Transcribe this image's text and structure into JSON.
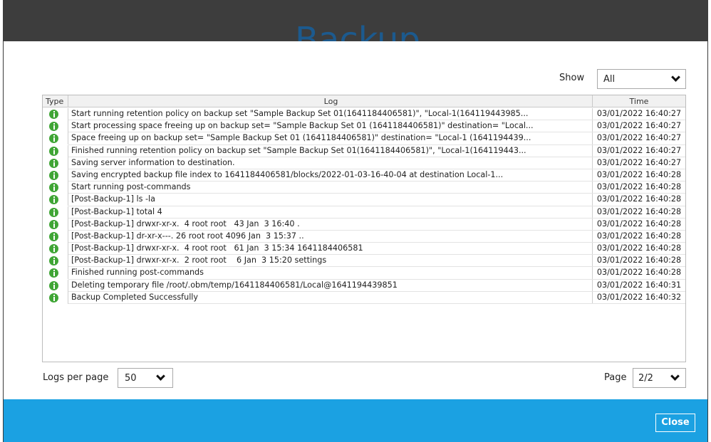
{
  "background_title": "Backup",
  "filter": {
    "label": "Show",
    "value": "All"
  },
  "table": {
    "headers": {
      "type": "Type",
      "log": "Log",
      "time": "Time"
    },
    "rows": [
      {
        "icon": "info-icon",
        "log": "Start running retention policy on backup set \"Sample Backup Set 01(1641184406581)\", \"Local-1(164119443985...",
        "time": "03/01/2022 16:40:27"
      },
      {
        "icon": "info-icon",
        "log": "Start processing space freeing up on backup set= \"Sample Backup Set 01 (1641184406581)\" destination= \"Local...",
        "time": "03/01/2022 16:40:27"
      },
      {
        "icon": "info-icon",
        "log": "Space freeing up on backup set= \"Sample Backup Set 01 (1641184406581)\" destination= \"Local-1 (1641194439...",
        "time": "03/01/2022 16:40:27"
      },
      {
        "icon": "info-icon",
        "log": "Finished running retention policy on backup set \"Sample Backup Set 01(1641184406581)\", \"Local-1(164119443...",
        "time": "03/01/2022 16:40:27"
      },
      {
        "icon": "info-icon",
        "log": "Saving server information to destination.",
        "time": "03/01/2022 16:40:27"
      },
      {
        "icon": "info-icon",
        "log": "Saving encrypted backup file index to 1641184406581/blocks/2022-01-03-16-40-04 at destination Local-1...",
        "time": "03/01/2022 16:40:28"
      },
      {
        "icon": "info-icon",
        "log": "Start running post-commands",
        "time": "03/01/2022 16:40:28"
      },
      {
        "icon": "info-icon",
        "log": "[Post-Backup-1] ls -la",
        "time": "03/01/2022 16:40:28"
      },
      {
        "icon": "info-icon",
        "log": "[Post-Backup-1] total 4",
        "time": "03/01/2022 16:40:28"
      },
      {
        "icon": "info-icon",
        "log": "[Post-Backup-1] drwxr-xr-x.  4 root root   43 Jan  3 16:40 .",
        "time": "03/01/2022 16:40:28"
      },
      {
        "icon": "info-icon",
        "log": "[Post-Backup-1] dr-xr-x---. 26 root root 4096 Jan  3 15:37 ..",
        "time": "03/01/2022 16:40:28"
      },
      {
        "icon": "info-icon",
        "log": "[Post-Backup-1] drwxr-xr-x.  4 root root   61 Jan  3 15:34 1641184406581",
        "time": "03/01/2022 16:40:28"
      },
      {
        "icon": "info-icon",
        "log": "[Post-Backup-1] drwxr-xr-x.  2 root root    6 Jan  3 15:20 settings",
        "time": "03/01/2022 16:40:28"
      },
      {
        "icon": "info-icon",
        "log": "Finished running post-commands",
        "time": "03/01/2022 16:40:28"
      },
      {
        "icon": "info-icon",
        "log": "Deleting temporary file /root/.obm/temp/1641184406581/Local@1641194439851",
        "time": "03/01/2022 16:40:31"
      },
      {
        "icon": "info-icon",
        "log": "Backup Completed Successfully",
        "time": "03/01/2022 16:40:32"
      }
    ]
  },
  "pagination": {
    "logs_per_page_label": "Logs per page",
    "logs_per_page_value": "50",
    "page_label": "Page",
    "page_value": "2/2"
  },
  "footer": {
    "close_label": "Close"
  },
  "colors": {
    "accent": "#1ba1e2",
    "info_icon": "#3fa535",
    "header_band": "#3d3d3d"
  }
}
